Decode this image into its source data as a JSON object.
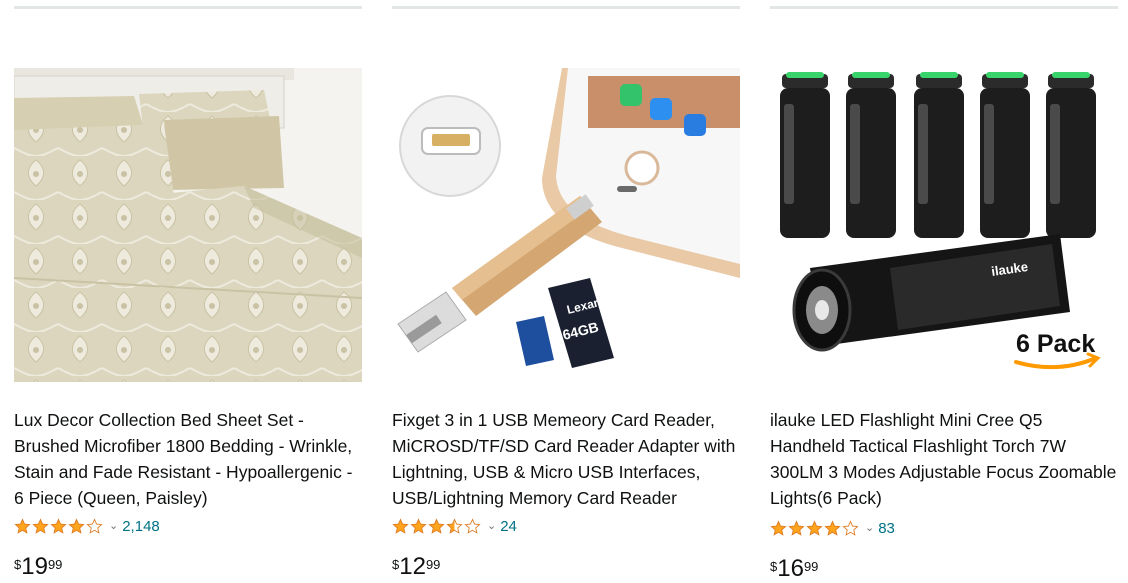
{
  "products": [
    {
      "title": "Lux Decor Collection Bed Sheet Set - Brushed Microfiber 1800 Bedding - Wrinkle, Stain and Fade Resistant - Hypoallergenic - 6 Piece (Queen, Paisley)",
      "image_desc": "bed-sheet-set-image",
      "rating": 4.0,
      "review_count": "2,148",
      "price_symbol": "$",
      "price_whole": "19",
      "price_fraction": "99"
    },
    {
      "title": "Fixget 3 in 1 USB Memeory Card Reader, MiCROSD/TF/SD Card Reader Adapter with Lightning, USB & Micro USB Interfaces, USB/Lightning Memory Card Reader",
      "image_desc": "card-reader-image",
      "rating": 3.5,
      "review_count": "24",
      "price_symbol": "$",
      "price_whole": "12",
      "price_fraction": "99",
      "image_text": {
        "brand": "Lexar",
        "capacity": "64GB"
      }
    },
    {
      "title": "ilauke LED Flashlight Mini Cree Q5 Handheld Tactical Flashlight Torch 7W 300LM 3 Modes Adjustable Focus Zoomable Lights(6 Pack)",
      "image_desc": "flashlight-pack-image",
      "rating": 4.0,
      "review_count": "83",
      "price_symbol": "$",
      "price_whole": "16",
      "price_fraction": "99",
      "image_text": {
        "brand": "ilauke",
        "badge": "6 Pack"
      }
    }
  ],
  "colors": {
    "star": "#ffa41c",
    "link": "#007185",
    "text": "#0f1111",
    "divider": "#e3e6e6",
    "amazon_orange": "#ff9900"
  }
}
